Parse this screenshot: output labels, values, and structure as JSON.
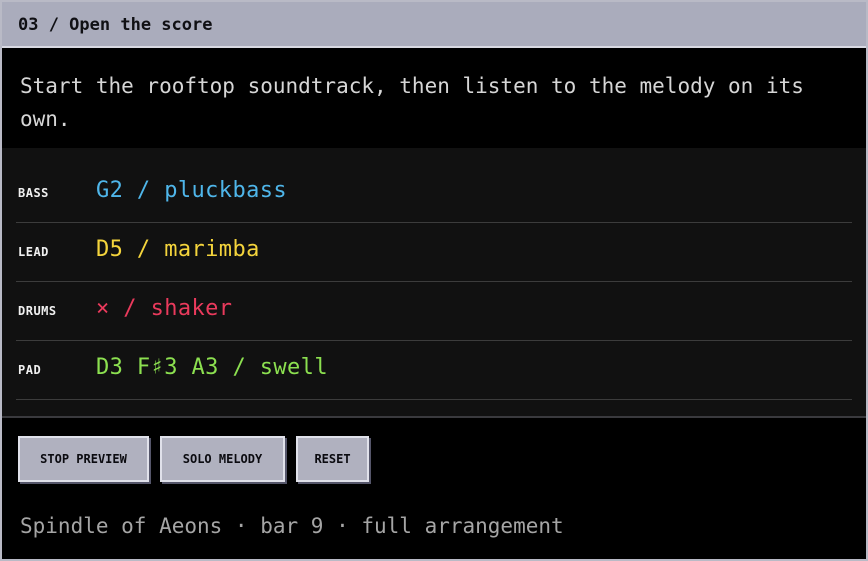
{
  "window": {
    "title": "03 / Open the score"
  },
  "instructions": "Start the rooftop soundtrack, then listen to the melody on its own.",
  "tracks": [
    {
      "label": "BASS",
      "value": "G2 / pluckbass",
      "color": "#4fb6ea"
    },
    {
      "label": "LEAD",
      "value": "D5 / marimba",
      "color": "#f4d43c"
    },
    {
      "label": "DRUMS",
      "value": "× / shaker",
      "color": "#ea3a5c"
    },
    {
      "label": "PAD",
      "value": "D3 F♯3 A3 / swell",
      "color": "#8ce050"
    }
  ],
  "buttons": {
    "stop_preview": "STOP PREVIEW",
    "solo_melody": "SOLO MELODY",
    "reset": "RESET"
  },
  "status": "Spindle of Aeons · bar 9 · full arrangement"
}
